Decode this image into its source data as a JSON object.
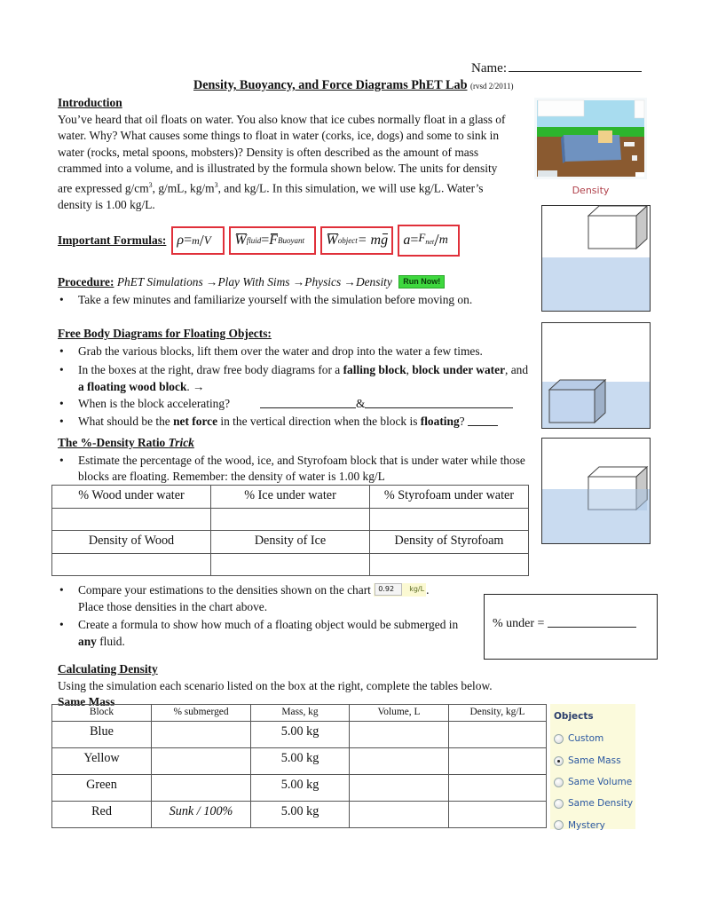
{
  "header": {
    "name_label": "Name:",
    "title": "Density, Buoyancy, and Force Diagrams PhET Lab",
    "revision": "(rvsd 2/2011)"
  },
  "introduction": {
    "heading": "Introduction",
    "text_1": "You’ve heard that oil floats on water.  You also know that ice cubes normally float in a glass of water.  Why?  What causes some things to float in water (corks, ice, dogs) and some to sink in water (rocks, metal spoons, mobsters)?  Density is often described as the amount of mass crammed into a volume, and is illustrated by the formula shown below.  The units for density are expressed g/cm",
    "sup_1": "3",
    "text_2": ", g/mL, kg/m",
    "sup_2": "3",
    "text_3": ", and kg/L.  In this simulation, we will use kg/L.  Water’s density is 1.00 kg/L."
  },
  "sim_thumbnail": {
    "caption": "Density",
    "colors": {
      "sky": "#a8dcef",
      "grass": "#2db52d",
      "ground": "#8a5a30",
      "pool": "#6e96c8",
      "block": "#f0d08a",
      "caption": "#b0404a"
    }
  },
  "formulas": {
    "label": "Important Formulas:",
    "density": {
      "lhs": "ρ",
      "eq": " = ",
      "num": "m",
      "den": "V"
    },
    "fluid": {
      "w": "W",
      "w_sub": "fluid",
      "eq": " = ",
      "f": "F",
      "f_sub": "Buoyant"
    },
    "object": {
      "w": "W",
      "w_sub": "object",
      "eq": " = m",
      "g": "g"
    },
    "accel": {
      "lhs": "a",
      "eq": " = ",
      "num": "F",
      "num_sub": "net",
      "den": "m"
    },
    "border_color": "#e0303a"
  },
  "procedure": {
    "label": "Procedure:",
    "path": [
      "PhET Simulations",
      "Play With Sims",
      "Physics",
      "Density"
    ],
    "arrow": "→",
    "run_button": "Run Now!",
    "bullet": "Take a few minutes and familiarize yourself with the simulation before moving on."
  },
  "free_body": {
    "heading": "Free Body Diagrams for Floating Objects:",
    "b1": "Grab the various blocks, lift them over the water and drop into the water a few times.",
    "b2_pre": "In the boxes at the right, draw free body diagrams for a ",
    "b2_bold1": "falling block",
    "b2_mid1": ", ",
    "b2_bold2": "block under water",
    "b2_mid2": ", and ",
    "b2_bold3": "a floating wood block",
    "b2_post": ".  →",
    "b3": "When is the block accelerating?",
    "b3_amp": "&",
    "b4_pre": "What should be the ",
    "b4_bold1": "net force",
    "b4_mid": " in the vertical direction when the block is ",
    "b4_bold2": "floating",
    "b4_post": "?"
  },
  "diagrams": [
    {
      "label": "falling-block",
      "block_position": "above-water-right"
    },
    {
      "label": "block-under-water",
      "block_position": "submerged-left"
    },
    {
      "label": "floating-block",
      "block_position": "floating-right"
    }
  ],
  "trick": {
    "heading": "The %-Density Ratio ",
    "heading_italic": "Trick",
    "bullet": "Estimate the percentage of the wood, ice, and Styrofoam block that is under water while those blocks are floating.  Remember: the density of water is 1.00 kg/L"
  },
  "ratio_table": {
    "rows": [
      [
        "% Wood under water",
        "% Ice under water",
        "% Styrofoam under water"
      ],
      [
        "",
        "",
        ""
      ],
      [
        "Density of Wood",
        "Density of Ice",
        "Density of Styrofoam"
      ],
      [
        "",
        "",
        ""
      ]
    ]
  },
  "compare": {
    "b1": "Compare your estimations to the densities shown on the chart ",
    "readout_value": "0.92",
    "readout_unit": "kg/L",
    "b1_end": ".",
    "b1_line2": "Place those densities in the chart above.",
    "b2_pre": "Create a formula to show how much of a floating object would be submerged in ",
    "b2_bold": "any",
    "b2_post": " fluid.",
    "under_label": "% under ="
  },
  "calculating": {
    "heading": "Calculating Density",
    "text": "Using the simulation each scenario listed on the box at the right, complete the tables below.",
    "subheading": "Same Mass"
  },
  "mass_table": {
    "headers": [
      "Block",
      "% submerged",
      "Mass, kg",
      "Volume, L",
      "Density, kg/L"
    ],
    "rows": [
      [
        "Blue",
        "",
        "5.00 kg",
        "",
        ""
      ],
      [
        "Yellow",
        "",
        "5.00 kg",
        "",
        ""
      ],
      [
        "Green",
        "",
        "5.00 kg",
        "",
        ""
      ],
      [
        "Red",
        "Sunk / 100%",
        "5.00 kg",
        "",
        ""
      ]
    ]
  },
  "objects_panel": {
    "title": "Objects",
    "options": [
      {
        "label": "Custom",
        "selected": false
      },
      {
        "label": "Same Mass",
        "selected": true
      },
      {
        "label": "Same Volume",
        "selected": false
      },
      {
        "label": "Same Density",
        "selected": false
      },
      {
        "label": "Mystery",
        "selected": false
      }
    ]
  }
}
